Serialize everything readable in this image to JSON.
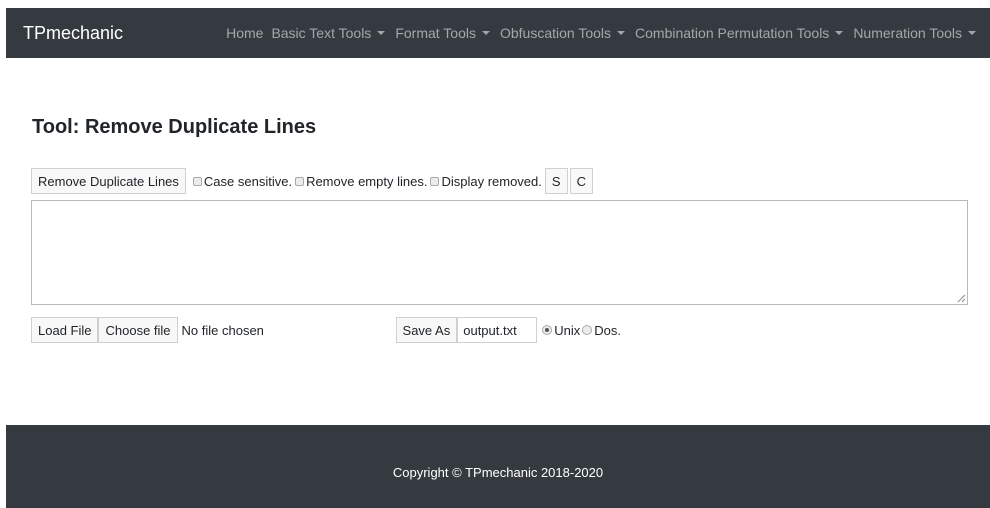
{
  "navbar": {
    "brand": "TPmechanic",
    "links": [
      {
        "label": "Home"
      },
      {
        "label": "Basic Text Tools"
      },
      {
        "label": "Format Tools"
      },
      {
        "label": "Obfuscation Tools"
      },
      {
        "label": "Combination Permutation Tools"
      },
      {
        "label": "Numeration Tools"
      }
    ]
  },
  "page": {
    "title": "Tool: Remove Duplicate Lines"
  },
  "toolbar": {
    "run_button": "Remove Duplicate Lines",
    "options": [
      {
        "label": "Case sensitive.",
        "checked": false
      },
      {
        "label": "Remove empty lines.",
        "checked": false
      },
      {
        "label": "Display removed.",
        "checked": false
      }
    ],
    "s_button": "S",
    "c_button": "C"
  },
  "editor": {
    "value": ""
  },
  "filebar": {
    "load_button": "Load File",
    "choose_button": "Choose file",
    "file_status": "No file chosen",
    "save_button": "Save As",
    "filename": "output.txt",
    "line_endings": [
      {
        "label": "Unix",
        "selected": true
      },
      {
        "label": "Dos.",
        "selected": false
      }
    ]
  },
  "footer": {
    "copyright": "Copyright © TPmechanic 2018-2020"
  }
}
